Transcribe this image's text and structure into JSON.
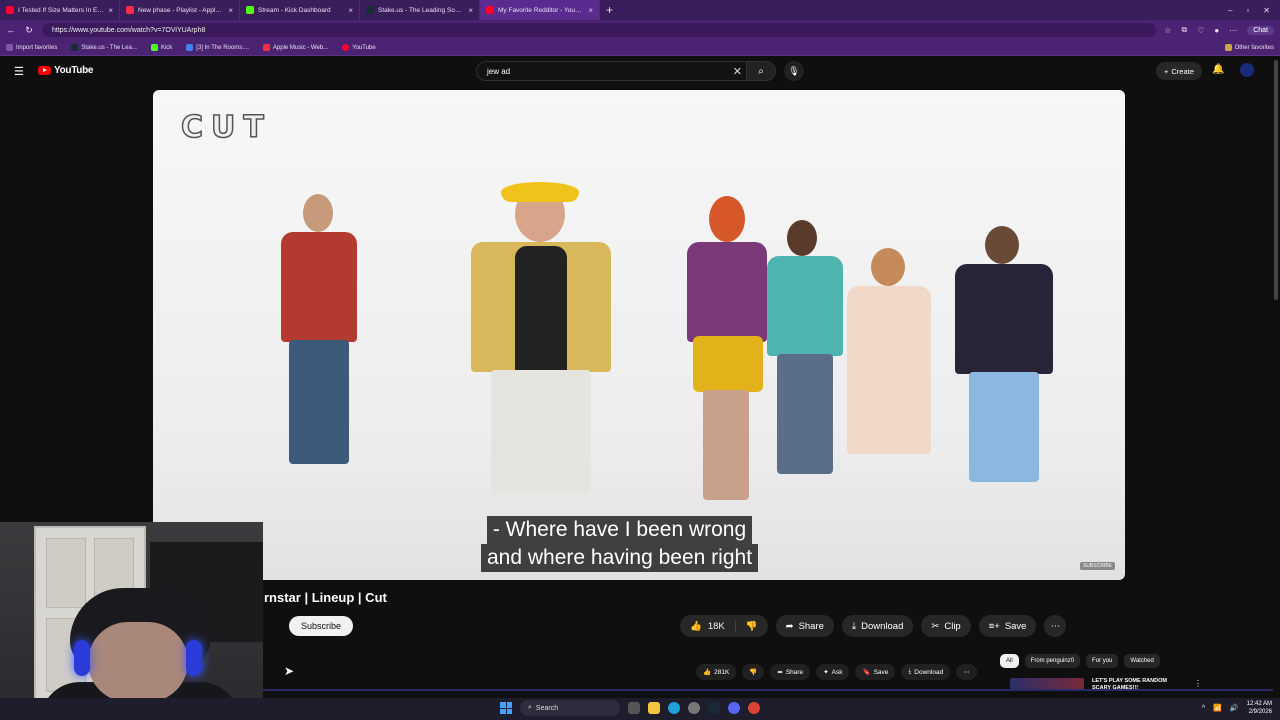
{
  "browser": {
    "tabs": [
      {
        "title": "I Tested If Size Matters In Every Sp",
        "color": "#ff0033"
      },
      {
        "title": "New phase - Playlist - Apple Music",
        "color": "#fa2d48"
      },
      {
        "title": "Stream - Kick Dashboard",
        "color": "#53fc18"
      },
      {
        "title": "Stake.us - The Leading Social Casi",
        "color": "#1a2c38"
      },
      {
        "title": "My Favorite Redditor - YouTube",
        "color": "#ff0033"
      }
    ],
    "url": "https://www.youtube.com/watch?v=7OViYUArph8",
    "chat_label": "Chat",
    "bookmarks": [
      "Import favorites",
      "Stake.us - The Lea...",
      "Kick",
      "[3] In The Rooms:...",
      "Apple Music - Web...",
      "YouTube"
    ],
    "other_favorites": "Other favorites"
  },
  "youtube": {
    "logo_text": "YouTube",
    "search_value": "jew ad",
    "create_label": "Create"
  },
  "video": {
    "channel_watermark": "CUT",
    "caption_line1": "- Where have I been wrong",
    "caption_line2": "and where having been right",
    "subscribe_watermark": "SUBSCRIBE",
    "title": "rnstar | Lineup | Cut",
    "subscribe_label": "Subscribe",
    "likes": "18K",
    "share_label": "Share",
    "download_label": "Download",
    "clip_label": "Clip",
    "save_label": "Save"
  },
  "lower": {
    "likes": "281K",
    "share_label": "Share",
    "ask_label": "Ask",
    "save_label": "Save",
    "download_label": "Download",
    "chips": [
      "All",
      "From penguinz0",
      "For you",
      "Watched"
    ],
    "rec_title": "LET'S PLAY SOME RANDOM SCARY GAMES!!!"
  },
  "taskbar": {
    "search_label": "Search",
    "time": "12:42 AM",
    "date": "2/9/2026"
  }
}
